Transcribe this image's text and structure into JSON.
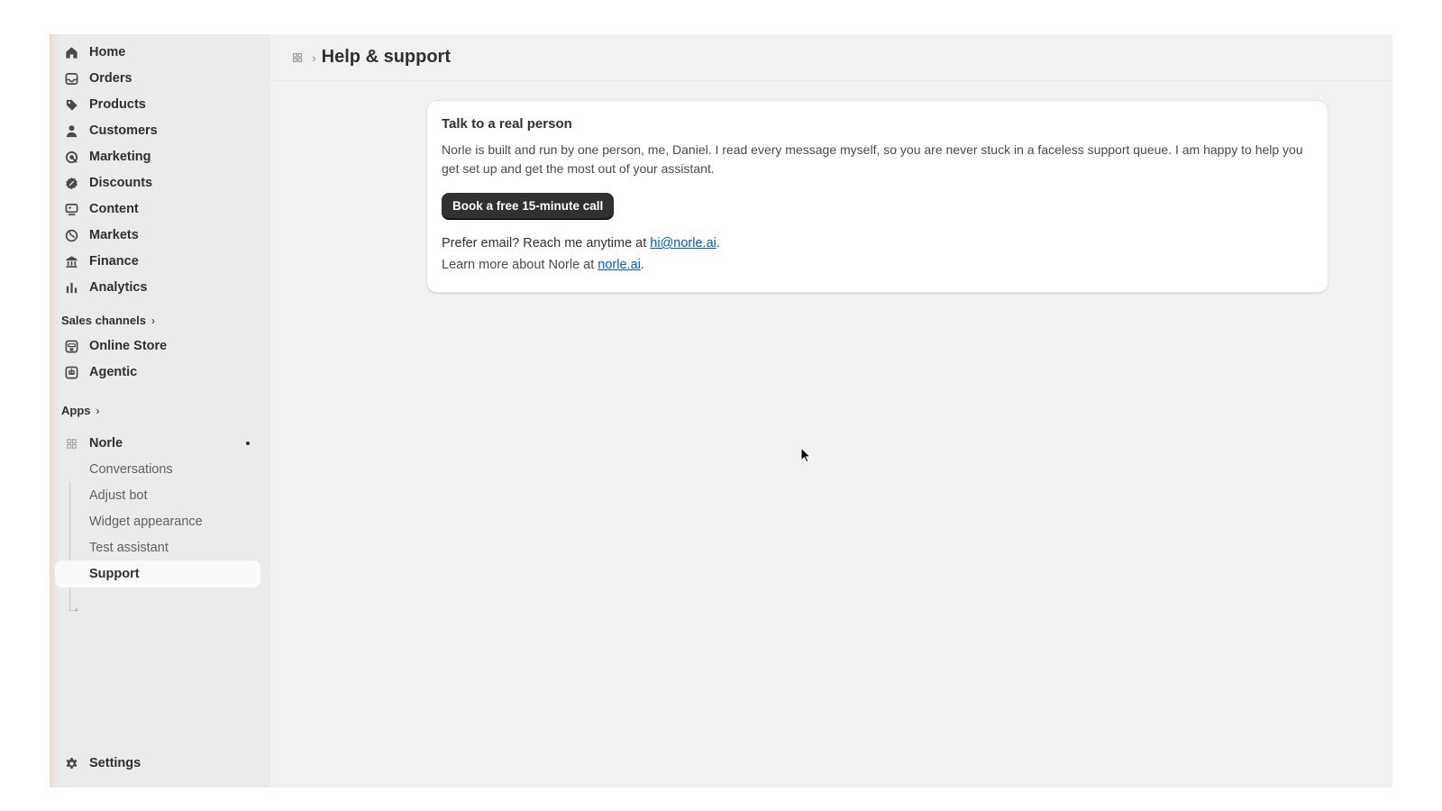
{
  "sidebar": {
    "nav": [
      {
        "label": "Home",
        "icon": "home-icon"
      },
      {
        "label": "Orders",
        "icon": "inbox-icon"
      },
      {
        "label": "Products",
        "icon": "tag-icon"
      },
      {
        "label": "Customers",
        "icon": "person-icon"
      },
      {
        "label": "Marketing",
        "icon": "target-icon"
      },
      {
        "label": "Discounts",
        "icon": "discount-icon"
      },
      {
        "label": "Content",
        "icon": "content-icon"
      },
      {
        "label": "Markets",
        "icon": "globe-icon"
      },
      {
        "label": "Finance",
        "icon": "bank-icon"
      },
      {
        "label": "Analytics",
        "icon": "bar-chart-icon"
      }
    ],
    "sales_channels_label": "Sales channels",
    "channels": [
      {
        "label": "Online Store",
        "icon": "store-icon"
      },
      {
        "label": "Agentic",
        "icon": "agent-icon"
      }
    ],
    "apps_label": "Apps",
    "app": {
      "label": "Norle",
      "icon": "app-grid-icon",
      "sub_items": [
        "Conversations",
        "Adjust bot",
        "Widget appearance",
        "Test assistant",
        "Support"
      ],
      "active_sub_item": "Support"
    },
    "settings_label": "Settings"
  },
  "header": {
    "title": "Help & support"
  },
  "card": {
    "title": "Talk to a real person",
    "body": "Norle is built and run by one person, me, Daniel. I read every message myself, so you are never stuck in a faceless support queue. I am happy to help you get set up and get the most out of your assistant.",
    "cta_label": "Book a free 15-minute call",
    "email_prefix": "Prefer email? Reach me anytime at ",
    "email_link": "hi@norle.ai",
    "email_suffix": ".",
    "learn_prefix": "Learn more about Norle at ",
    "learn_link": "norle.ai",
    "learn_suffix": "."
  },
  "colors": {
    "primary_button": "#303030",
    "link": "#005bd3",
    "sidebar_bg": "#ebebeb",
    "main_bg": "#f1f1f1"
  }
}
